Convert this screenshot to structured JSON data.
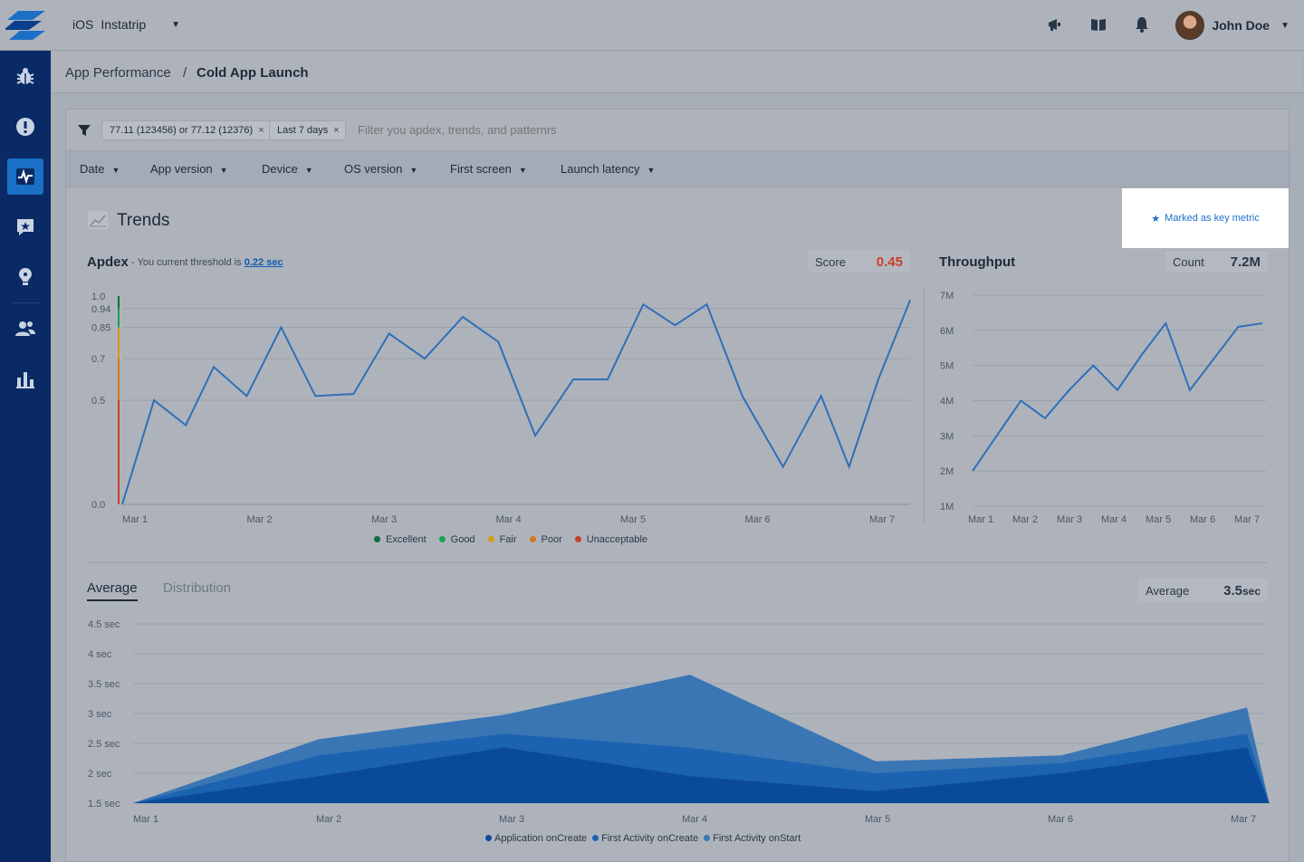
{
  "header": {
    "platform": "iOS",
    "app_name": "Instatrip",
    "user_name": "John Doe",
    "icons": [
      "megaphone-icon",
      "book-icon",
      "bell-icon"
    ]
  },
  "sidebar": {
    "items": [
      {
        "icon": "bug-icon",
        "active": false
      },
      {
        "icon": "alert-icon",
        "active": false
      },
      {
        "icon": "performance-icon",
        "active": true
      },
      {
        "icon": "feedback-icon",
        "active": false
      },
      {
        "icon": "feature-request-icon",
        "active": false
      },
      {
        "icon": "users-icon",
        "active": false
      },
      {
        "icon": "analytics-icon",
        "active": false
      }
    ]
  },
  "breadcrumb": {
    "parent": "App Performance",
    "separator": "/",
    "current": "Cold App Launch"
  },
  "filters": {
    "chips": [
      {
        "label": "77.11 (123456) or 77.12 (12376)"
      },
      {
        "label": "Last 7 days"
      }
    ],
    "placeholder": "Filter you apdex, trends, and patternrs",
    "dropdowns": [
      "Date",
      "App version",
      "Device",
      "OS version",
      "First screen",
      "Launch latency"
    ]
  },
  "trends": {
    "title": "Trends",
    "key_metric_label": "Marked as key metric"
  },
  "apdex": {
    "title": "Apdex",
    "note_prefix": "- You current threshold is",
    "threshold": "0.22 sec",
    "score_label": "Score",
    "score_value": "0.45",
    "legend": [
      {
        "label": "Excellent",
        "color": "#0a6e3a"
      },
      {
        "label": "Good",
        "color": "#16a35a"
      },
      {
        "label": "Fair",
        "color": "#d49a12"
      },
      {
        "label": "Poor",
        "color": "#d4761a"
      },
      {
        "label": "Unacceptable",
        "color": "#c8402a"
      }
    ]
  },
  "throughput": {
    "title": "Throughput",
    "count_label": "Count",
    "count_value": "7.2M"
  },
  "latency": {
    "tabs": [
      {
        "label": "Average",
        "active": true
      },
      {
        "label": "Distribution",
        "active": false
      }
    ],
    "average_label": "Average",
    "average_value": "3.5",
    "average_unit": "sec",
    "legend": [
      {
        "label": "Application onCreate",
        "color": "#0a4a9a"
      },
      {
        "label": "First Activity onCreate",
        "color": "#1b63b0"
      },
      {
        "label": "First Activity onStart",
        "color": "#3a76b4"
      }
    ]
  },
  "chart_data": [
    {
      "type": "line",
      "title": "Apdex",
      "y_tick_labels": [
        "1.0",
        "0.94",
        "0.85",
        "0.7",
        "0.5",
        "0.0"
      ],
      "y_tick_values": [
        1.0,
        0.94,
        0.85,
        0.7,
        0.5,
        0.0
      ],
      "x_tick_labels": [
        "Mar 1",
        "Mar 2",
        "Mar 3",
        "Mar 4",
        "Mar 5",
        "Mar 6",
        "Mar 7"
      ],
      "x_range": [
        1,
        7.2
      ],
      "series": [
        {
          "color": "#2f6fb8",
          "x": [
            1.0,
            1.25,
            1.5,
            1.72,
            1.98,
            2.25,
            2.52,
            2.82,
            3.1,
            3.38,
            3.68,
            3.96,
            4.25,
            4.55,
            4.82,
            5.1,
            5.35,
            5.6,
            5.88,
            6.2,
            6.5,
            6.72,
            6.95,
            7.2
          ],
          "y": [
            0.0,
            0.5,
            0.38,
            0.66,
            0.52,
            0.85,
            0.52,
            0.53,
            0.82,
            0.7,
            0.9,
            0.78,
            0.33,
            0.6,
            0.6,
            0.96,
            0.86,
            0.96,
            0.52,
            0.18,
            0.52,
            0.18,
            0.6,
            0.98
          ]
        }
      ]
    },
    {
      "type": "line",
      "title": "Throughput",
      "y_tick_labels": [
        "7M",
        "6M",
        "5M",
        "4M",
        "3M",
        "2M",
        "1M"
      ],
      "y_range": [
        1,
        7
      ],
      "x_tick_labels": [
        "Mar 1",
        "Mar 2",
        "Mar 3",
        "Mar 4",
        "Mar 5",
        "Mar 6",
        "Mar 7"
      ],
      "series": [
        {
          "color": "#2f6fb8",
          "x": [
            1.0,
            1.5,
            2.0,
            2.5,
            3.0,
            3.5,
            4.0,
            4.5,
            5.0,
            5.5,
            6.0,
            6.5,
            7.0
          ],
          "y": [
            2.0,
            3.0,
            4.0,
            3.5,
            4.3,
            5.0,
            4.3,
            5.3,
            6.2,
            4.3,
            5.2,
            6.1,
            6.2
          ]
        }
      ]
    },
    {
      "type": "area",
      "title": "",
      "y_tick_labels": [
        "4.5 sec",
        "4 sec",
        "3.5 sec",
        "3 sec",
        "2.5 sec",
        "2 sec",
        "1.5 sec"
      ],
      "y_range": [
        1.5,
        4.5
      ],
      "x_tick_labels": [
        "Mar 1",
        "Mar 2",
        "Mar 3",
        "Mar 4",
        "Mar 5",
        "Mar 6",
        "Mar 7"
      ],
      "x": [
        1,
        2,
        3,
        4,
        5,
        6,
        7,
        7.12
      ],
      "series": [
        {
          "name": "First Activity onStart",
          "color": "#3a76b4",
          "values": [
            1.5,
            2.57,
            2.98,
            3.65,
            2.2,
            2.3,
            3.1,
            1.5
          ]
        },
        {
          "name": "First Activity onCreate",
          "color": "#1b63b0",
          "values": [
            1.5,
            2.3,
            2.66,
            2.43,
            2.0,
            2.17,
            2.66,
            1.5
          ]
        },
        {
          "name": "Application onCreate",
          "color": "#0a4a9a",
          "values": [
            1.5,
            1.95,
            2.43,
            1.95,
            1.7,
            2.0,
            2.43,
            1.5
          ]
        }
      ]
    }
  ]
}
